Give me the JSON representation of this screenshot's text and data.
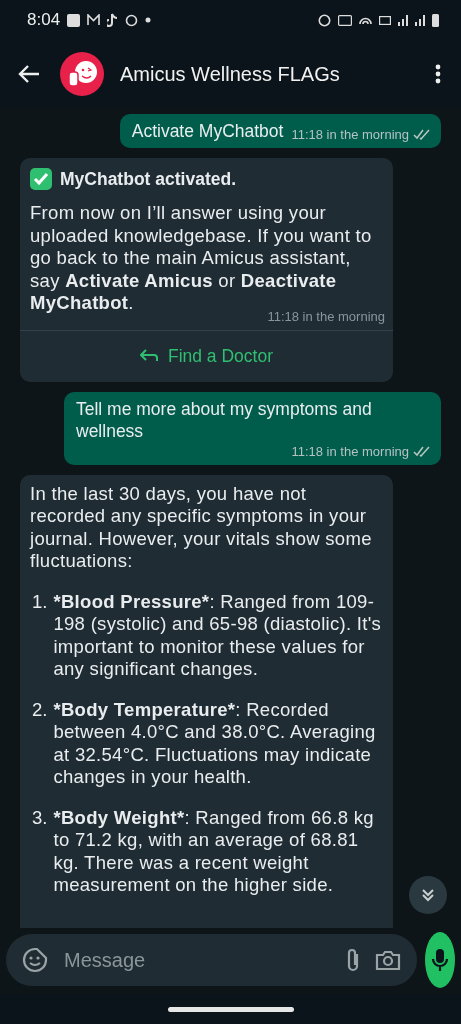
{
  "status_bar": {
    "time": "8:04"
  },
  "header": {
    "title": "Amicus Wellness FLAGs"
  },
  "messages": [
    {
      "kind": "outgoing",
      "text": "Activate MyChatbot",
      "time": "11:18 in the morning"
    },
    {
      "kind": "bot",
      "heading": "MyChatbot activated.",
      "text": "From now on I’ll answer using your uploaded knowledgebase. If you want to go back to the main Amicus assistant, say **Activate Amicus** or **Deactivate MyChatbot**.",
      "time": "11:18 in the morning",
      "action": "Find a Doctor"
    },
    {
      "kind": "outgoing",
      "text": "Tell me more about my symptoms and wellness",
      "time": "11:18 in the morning"
    },
    {
      "kind": "list",
      "text": "In the last 30 days, you have not recorded any specific symptoms in your journal. However, your vitals show some fluctuations:",
      "items": [
        {
          "number": "1.",
          "title": "*Blood Pressure*",
          "text": ": Ranged from 109-198 (systolic) and 65-98 (diastolic). It's important to monitor these values for any significant changes."
        },
        {
          "number": "2.",
          "title": "*Body Temperature*",
          "text": ": Recorded between 4.0°C and 38.0°C. Averaging at 32.54°C. Fluctuations may indicate changes in your health."
        },
        {
          "number": "3.",
          "title": "*Body Weight*",
          "text": ": Ranged from 66.8 kg to 71.2 kg, with an average of 68.81 kg. There was a recent weight measurement on the higher side."
        }
      ]
    }
  ],
  "composer": {
    "placeholder": "Message"
  }
}
